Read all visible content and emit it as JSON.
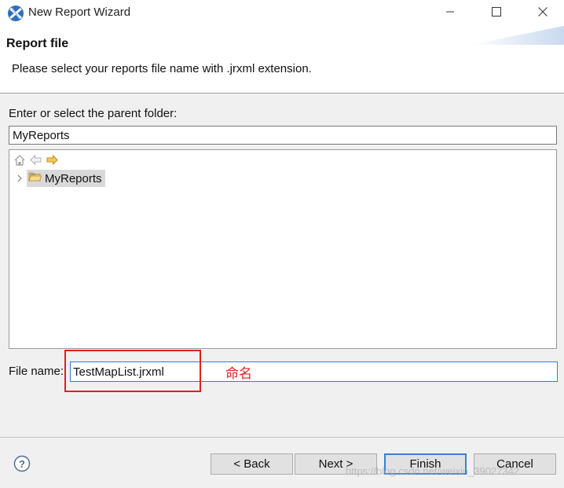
{
  "window": {
    "title": "New Report Wizard",
    "icon": "eclipse-app-icon",
    "controls": [
      "minimize-icon",
      "maximize-icon",
      "close-icon"
    ]
  },
  "header": {
    "title": "Report file",
    "description": "Please select your reports file name with .jrxml extension."
  },
  "folder": {
    "label": "Enter or select the parent folder:",
    "value": "MyReports"
  },
  "tree": {
    "toolbar_icons": [
      "home-icon",
      "back-arrow-icon",
      "forward-arrow-icon"
    ],
    "items": [
      {
        "label": "MyReports",
        "icon": "open-folder-icon",
        "selected": true,
        "expandable": true
      }
    ]
  },
  "file": {
    "label": "File name:",
    "value": "TestMapList.jrxml"
  },
  "annotation": {
    "text": "命名",
    "color": "#e02020"
  },
  "buttons": {
    "back": "< Back",
    "next": "Next >",
    "finish": "Finish",
    "cancel": "Cancel"
  },
  "watermark": "https://blog.csdn.net/weixin_39027342",
  "colors": {
    "accent": "#3c7fd6",
    "annotation_red": "#e02020",
    "selection": "#d9d9d9"
  }
}
